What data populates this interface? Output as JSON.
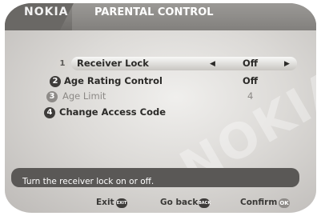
{
  "header": {
    "brand": "NOKIA",
    "title": "PARENTAL CONTROL"
  },
  "menu": {
    "items": [
      {
        "number": "1",
        "label": "Receiver Lock",
        "value": "Off"
      },
      {
        "number": "2",
        "label": "Age Rating Control",
        "value": "Off"
      },
      {
        "number": "3",
        "label": "Age Limit",
        "value": "4"
      },
      {
        "number": "4",
        "label": "Change Access Code",
        "value": ""
      }
    ],
    "arrow_left": "◀",
    "arrow_right": "▶"
  },
  "watermark": "NOKIA",
  "info": {
    "text": "Turn the receiver lock on or off."
  },
  "footer": {
    "exit_label": "Exit",
    "exit_key": "EXIT",
    "back_label": "Go back",
    "back_key": "BACK",
    "confirm_label": "Confirm",
    "confirm_key": "OK"
  }
}
